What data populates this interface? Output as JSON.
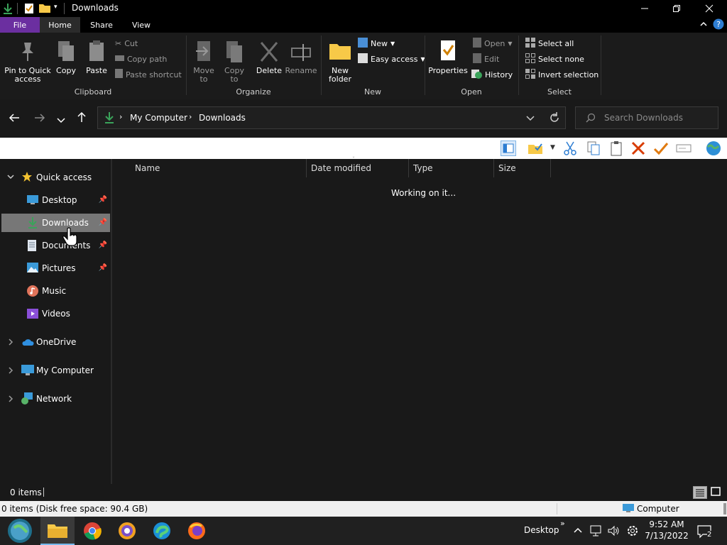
{
  "window": {
    "title": "Downloads"
  },
  "tabs": {
    "file": "File",
    "home": "Home",
    "share": "Share",
    "view": "View"
  },
  "ribbon": {
    "pin": "Pin to Quick access",
    "copy": "Copy",
    "paste": "Paste",
    "cut": "Cut",
    "copy_path": "Copy path",
    "paste_shortcut": "Paste shortcut",
    "clipboard_group": "Clipboard",
    "move_to": "Move to",
    "copy_to": "Copy to",
    "delete": "Delete",
    "rename": "Rename",
    "organize_group": "Organize",
    "new_folder": "New folder",
    "new_item": "New",
    "easy_access": "Easy access",
    "new_group": "New",
    "properties": "Properties",
    "open": "Open",
    "edit": "Edit",
    "history": "History",
    "open_group": "Open",
    "select_all": "Select all",
    "select_none": "Select none",
    "invert_selection": "Invert selection",
    "select_group": "Select"
  },
  "address": {
    "root": "My Computer",
    "current": "Downloads",
    "search_placeholder": "Search Downloads"
  },
  "nav": {
    "quick_access": "Quick access",
    "desktop": "Desktop",
    "downloads": "Downloads",
    "documents": "Documents",
    "pictures": "Pictures",
    "music": "Music",
    "videos": "Videos",
    "onedrive": "OneDrive",
    "my_computer": "My Computer",
    "network": "Network"
  },
  "columns": {
    "name": "Name",
    "date_modified": "Date modified",
    "type": "Type",
    "size": "Size"
  },
  "content": {
    "loading": "Working on it..."
  },
  "status": {
    "items": "0 items",
    "disk": "0 items (Disk free space: 90.4 GB)",
    "location": "Computer"
  },
  "taskbar": {
    "desktop": "Desktop",
    "time": "9:52 AM",
    "date": "7/13/2022",
    "notifications": "2"
  },
  "colors": {
    "accent_purple": "#6b2fa0",
    "download_green": "#3aa35a",
    "selected_bg": "#777777"
  }
}
